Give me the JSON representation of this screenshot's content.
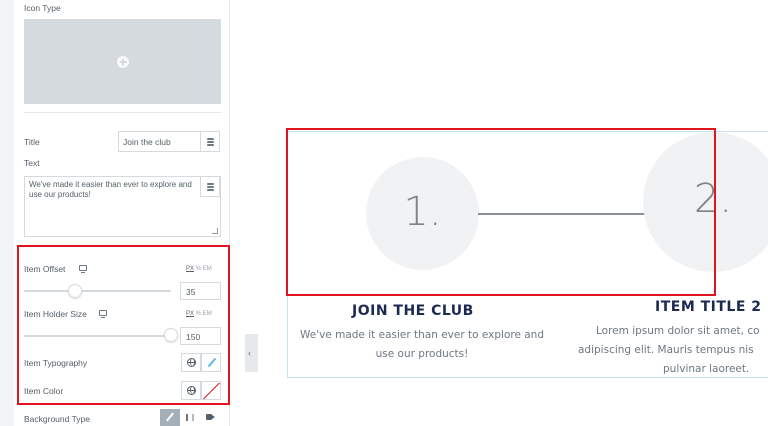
{
  "panel": {
    "icon_type_label": "Icon Type",
    "title_label": "Title",
    "title_value": "Join the club",
    "text_label": "Text",
    "text_value": "We've made it easier than ever to explore and use our products!",
    "item_offset": {
      "label": "Item Offset",
      "units": [
        "PX",
        "%",
        "EM"
      ],
      "value": "35",
      "slider_fraction": 0.35
    },
    "item_holder_size": {
      "label": "Item Holder Size",
      "units": [
        "PX",
        "%",
        "EM"
      ],
      "value": "150",
      "slider_fraction": 1.0
    },
    "item_typography_label": "Item Typography",
    "item_color_label": "Item Color",
    "background_type_label": "Background Type"
  },
  "preview": {
    "items": [
      {
        "number": "1.",
        "title": "JOIN THE CLUB",
        "description_lines": [
          "We've made it easier than ever to explore and",
          "use our products!"
        ]
      },
      {
        "number": "2.",
        "title": "ITEM TITLE 2",
        "description_lines": [
          "Lorem ipsum dolor sit amet, co",
          "adipiscing elit. Mauris tempus nis",
          "pulvinar laoreet."
        ]
      }
    ]
  },
  "colors": {
    "highlight": "#e0141e",
    "title_text": "#1c2a52",
    "accent_blue": "#63bcea",
    "circle_fill": "#f1f2f3"
  },
  "icons": [
    "plus-icon",
    "database-icon",
    "monitor-icon",
    "globe-icon",
    "pencil-icon",
    "chevron-left-icon",
    "brush-icon",
    "gradient-icon",
    "video-icon"
  ]
}
